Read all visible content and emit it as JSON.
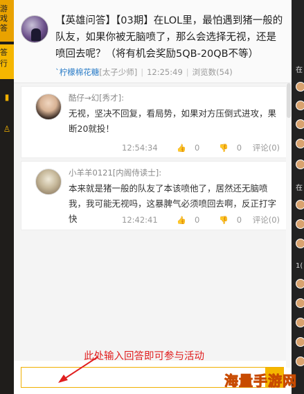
{
  "left_strip": {
    "logo_text": "游戏\n答",
    "tab_text": "答\n行"
  },
  "question": {
    "title": "【英雄问答】【03期】在LOL里，最怕遇到猪一般的队友，如果你被无脑喷了，那么会选择无视，还是喷回去呢？（将有机会奖励5QB-20QB不等）",
    "author": "`柠檬棉花糖",
    "author_tag": "[太子少师]",
    "time": "12:25:49",
    "views": "浏览数(54)"
  },
  "answers": [
    {
      "user": "酷仔→幻[秀才]:",
      "text": "无视，坚决不回复，看局势，如果对方压倒式进攻，果断20就投！",
      "time": "12:54:34",
      "likes": "0",
      "dislikes": "0",
      "comments": "评论(0)"
    },
    {
      "user": "小羊羊0121[内阁侍读士]:",
      "text": "本来就是猪一般的队友了本该喷他了，居然还无脑喷我，我可能无视吗，这暴脾气必须喷回去啊，反正打字快",
      "time": "12:42:41",
      "likes": "0",
      "dislikes": "0",
      "comments": "评论(0)"
    }
  ],
  "input": {
    "value": "",
    "placeholder": ""
  },
  "annotation": "此处输入回答即可参与活动",
  "right_strip": {
    "labels": [
      "在",
      "在",
      "1("
    ]
  },
  "watermark": "海量手游网",
  "colors": {
    "accent": "#f5b600",
    "author_link": "#2a7cc7",
    "annotation": "#e02020"
  }
}
